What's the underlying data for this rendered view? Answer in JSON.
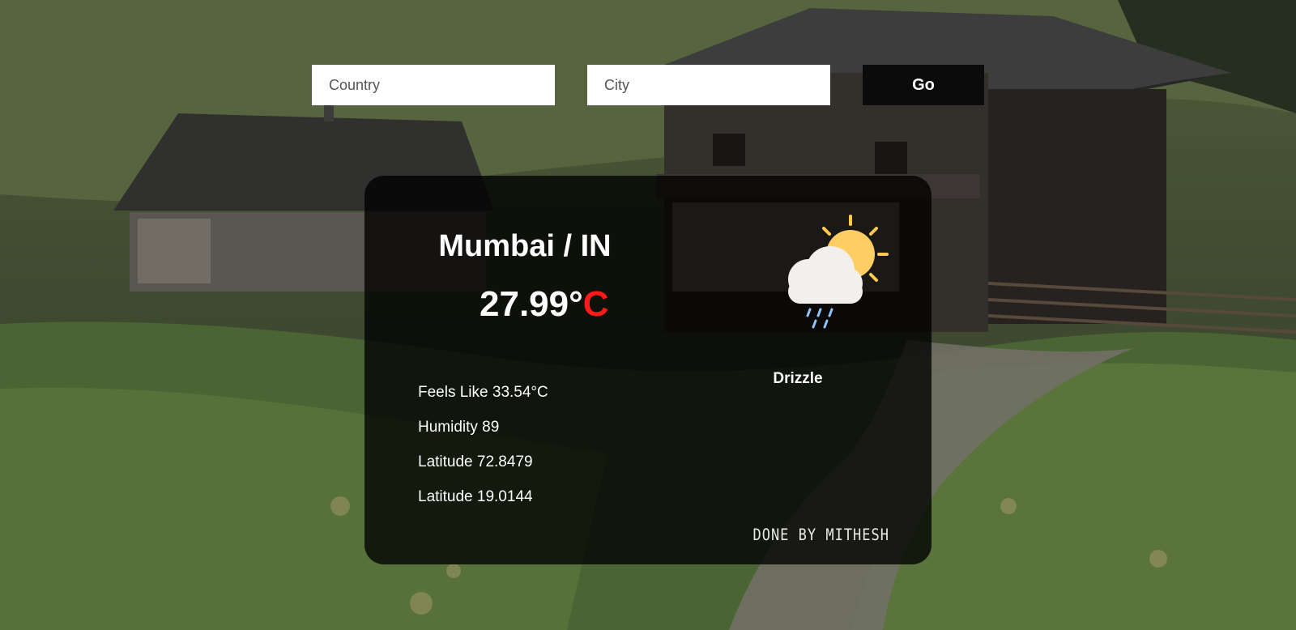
{
  "search": {
    "country_placeholder": "Country",
    "city_placeholder": "City",
    "go_label": "Go"
  },
  "weather": {
    "location": "Mumbai / IN",
    "temperature_value": "27.99°",
    "temperature_unit": "C",
    "feels_like": "Feels Like 33.54°C",
    "humidity": "Humidity 89",
    "coord_1": "Latitude 72.8479",
    "coord_2": "Latitude 19.0144",
    "condition": "Drizzle",
    "icon": "cloud-sun-rain-icon"
  },
  "footer": {
    "credit": "DONE BY MITHESH"
  },
  "colors": {
    "temperature_unit": "#ff1a1a",
    "card_background": "rgba(0,0,0,0.78)",
    "go_button": "#0b0b0b"
  }
}
